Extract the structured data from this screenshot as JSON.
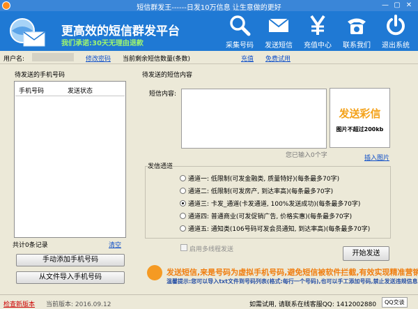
{
  "window": {
    "title": "短信群发王------日发10万信息 让生意做的更好",
    "controls": [
      "—",
      "▢",
      "✕"
    ]
  },
  "header": {
    "slogan": "更高效的短信群发平台",
    "promise": "我们承诺:30天无理由退款",
    "nav": [
      {
        "label": "采集号码",
        "icon": "search-icon"
      },
      {
        "label": "发送短信",
        "icon": "envelope-icon"
      },
      {
        "label": "充值中心",
        "icon": "yen-icon"
      },
      {
        "label": "联系我们",
        "icon": "phone-icon"
      },
      {
        "label": "退出系统",
        "icon": "power-icon"
      }
    ]
  },
  "infobar": {
    "user_label": "用户名:",
    "change_password": "修改密码",
    "balance_label": "当前剩余短信数量(条数)",
    "recharge": "充值",
    "free_trial": "免费试用"
  },
  "left_panel": {
    "title": "待发送的手机号码",
    "columns": [
      "手机号码",
      "发送状态"
    ],
    "record_count": "共计0条记录",
    "clear": "清空",
    "add_manual": "手动添加手机号码",
    "import_file": "从文件导入手机号码"
  },
  "right_panel": {
    "title": "待发送的短信内容",
    "content_label": "短信内容:",
    "char_count": "您已输入0个字",
    "insert_image": "插入图片",
    "promo_big": "发送彩信",
    "promo_small": "图片不超过200kb",
    "channel_title": "发信通道",
    "channels": [
      {
        "text": "通道一: 低限制(可发金融类, 质量特好)(每条最多70字)",
        "selected": false
      },
      {
        "text": "通道二: 低限制(可发房产, 到达率高)(每条最多70字)",
        "selected": false
      },
      {
        "text": "通道三: 卡发_通道(卡发通道, 100%发送成功)(每条最多70字)",
        "selected": true
      },
      {
        "text": "通道四: 普通商业(可发促销广告, 价格实惠)(每条最多70字)",
        "selected": false
      },
      {
        "text": "通道五: 通知类(106号码可发会员通知, 到达率高)(每条最多70字)",
        "selected": false
      }
    ],
    "multithread": "启用多线程发送",
    "send_button": "开始发送",
    "notice_line1": "发送短信,来是号码为虚拟手机号码,避免短信被软件拦截,有效实现精准营销",
    "notice_line2": "温馨提示:您可以导入txt文件到号码列表(格式:每行一个号码),也可以手工添加号码,禁止发送违规信息"
  },
  "statusbar": {
    "check_update": "检查新版本",
    "version": "当前版本: 2016.09.12",
    "contact": "如需试用, 请联系在线客服QQ: 1412002880",
    "qq_badge": "QQ交谈"
  },
  "colors": {
    "header_blue": "#1f79d4",
    "titlebar_blue": "#3a86d8",
    "promise_green": "#9ff56e",
    "link_blue": "#1050c8",
    "notice_orange": "#f07e10"
  }
}
